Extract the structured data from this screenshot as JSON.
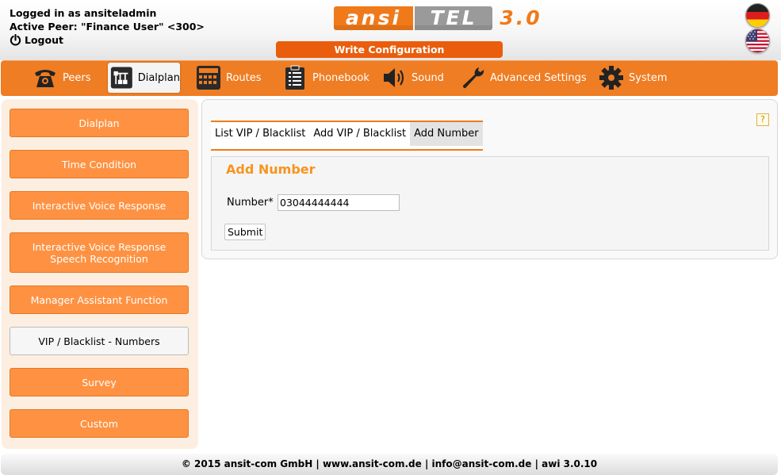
{
  "header": {
    "logged_in": "Logged in as ansiteladmin",
    "active_peer": "Active Peer: \"Finance User\" <300>",
    "logout": "Logout",
    "logo": {
      "part1": "ansi",
      "part2": "TEL",
      "version": "3.0"
    },
    "write_config": "Write Configuration",
    "languages": [
      {
        "icon": "flag-germany-icon"
      },
      {
        "icon": "flag-usa-icon"
      }
    ]
  },
  "nav": {
    "items": [
      {
        "label": "Peers",
        "icon": "telephone-icon"
      },
      {
        "label": "Dialplan",
        "icon": "dialplan-icon",
        "active": true
      },
      {
        "label": "Routes",
        "icon": "routes-icon"
      },
      {
        "label": "Phonebook",
        "icon": "phonebook-icon"
      },
      {
        "label": "Sound",
        "icon": "speaker-icon"
      },
      {
        "label": "Advanced Settings",
        "icon": "wrench-icon"
      },
      {
        "label": "System",
        "icon": "gear-icon"
      }
    ]
  },
  "sidebar": {
    "items": [
      {
        "label": "Dialplan"
      },
      {
        "label": "Time Condition"
      },
      {
        "label": "Interactive Voice Response"
      },
      {
        "label": "Interactive Voice Response Speech Recognition"
      },
      {
        "label": "Manager Assistant Function"
      },
      {
        "label": "VIP / Blacklist - Numbers",
        "active": true
      },
      {
        "label": "Survey"
      },
      {
        "label": "Custom"
      }
    ]
  },
  "main": {
    "help": "?",
    "tabs": [
      {
        "label": "List VIP / Blacklist"
      },
      {
        "label": "Add VIP / Blacklist"
      },
      {
        "label": "Add Number",
        "active": true
      }
    ],
    "form": {
      "title": "Add Number",
      "number_label": "Number*",
      "number_value": "03044444444",
      "submit": "Submit"
    }
  },
  "footer": {
    "text": "© 2015 ansit-com GmbH | www.ansit-com.de | info@ansit-com.de | awi 3.0.10"
  },
  "colors": {
    "accent": "#ef7d23",
    "button": "#fe9242",
    "title": "#f7941d",
    "write_config": "#ea5d0c"
  }
}
